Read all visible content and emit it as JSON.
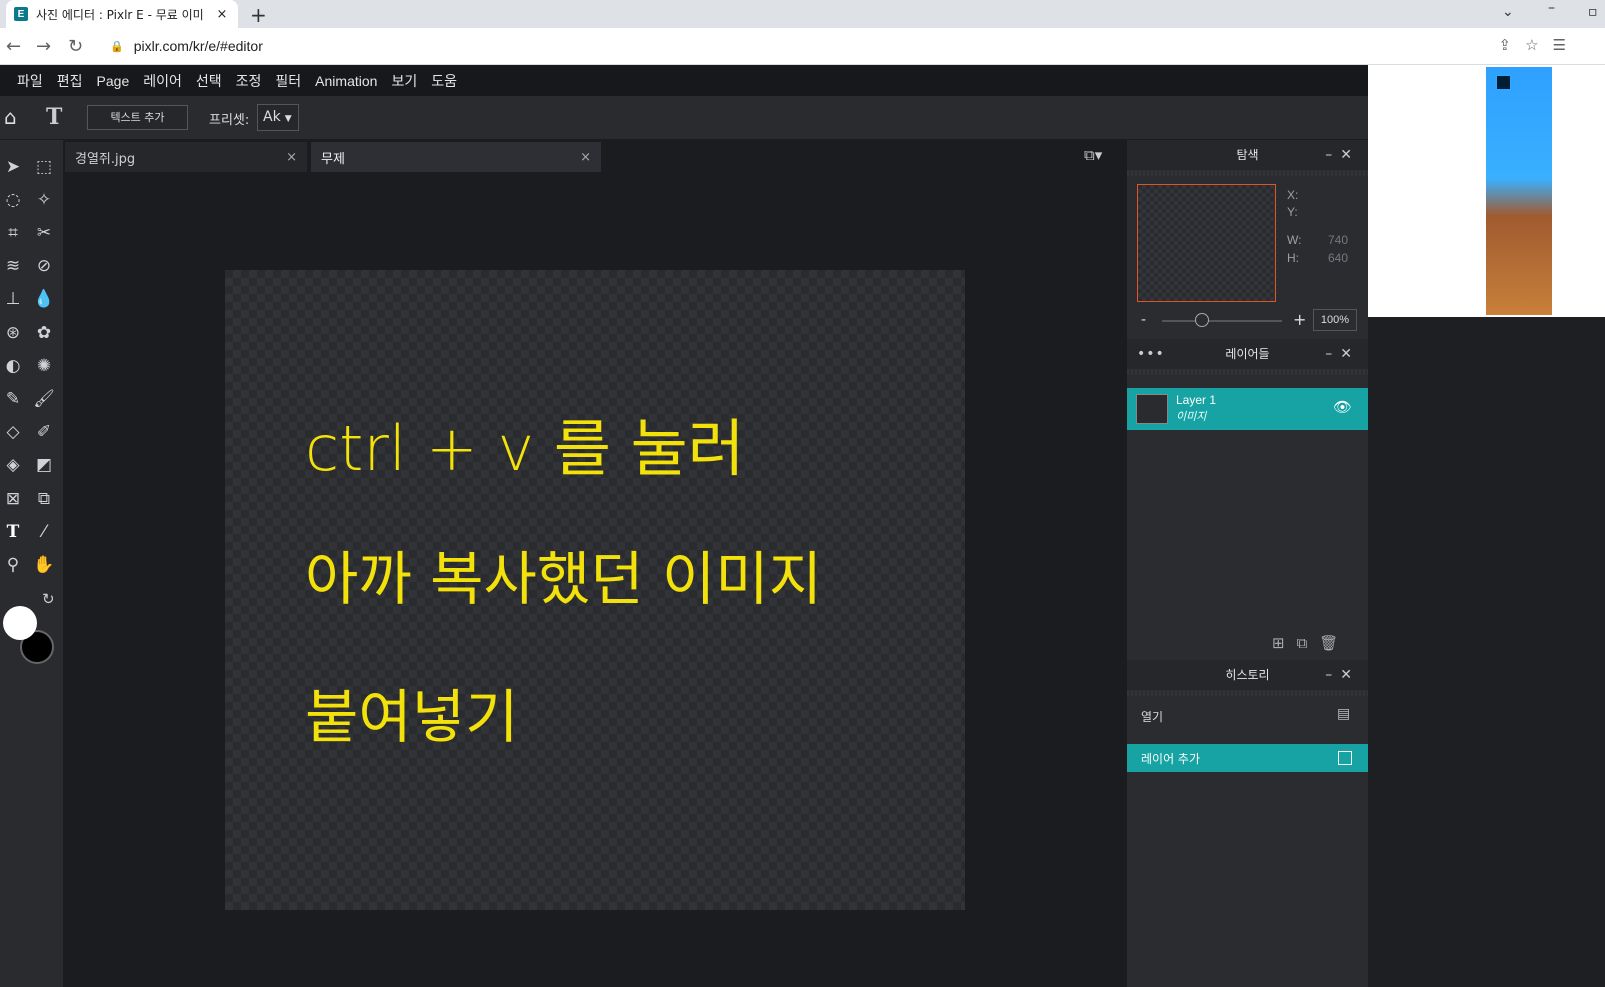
{
  "browser": {
    "tab_title": "사진 에디터 : Pixlr E - 무료 이미",
    "favicon_letter": "E",
    "close_glyph": "×",
    "new_tab_glyph": "+",
    "url": "pixlr.com/kr/e/#editor"
  },
  "menu": [
    "파일",
    "편집",
    "Page",
    "레이어",
    "선택",
    "조정",
    "필터",
    "Animation",
    "보기",
    "도움"
  ],
  "toolbar_options": {
    "add_text_label": "텍스트 추가",
    "preset_label": "프리셋:",
    "preset_value": "Ak"
  },
  "documents": {
    "tabs": [
      {
        "label": "경열쥐.jpg",
        "active": false
      },
      {
        "label": "무제",
        "active": true
      }
    ]
  },
  "canvas_text": {
    "line1": "ctrl + v 를 눌러",
    "line2": "아까 복사했던 이미지",
    "line3": "붙여넣기"
  },
  "navigator": {
    "title": "탐색",
    "x_label": "X:",
    "y_label": "Y:",
    "w_label": "W:",
    "w_value": "740",
    "h_label": "H:",
    "h_value": "640",
    "zoom": "100%",
    "zoom_fraction": 0.33
  },
  "layers": {
    "title": "레이어들",
    "items": [
      {
        "name": "Layer 1",
        "type": "이미지"
      }
    ]
  },
  "history": {
    "title": "히스토리",
    "items": [
      "열기",
      "레이어 추가"
    ]
  },
  "colors": {
    "accent": "#17a3a3",
    "canvas_text": "#f2e10a",
    "primary_color": "#ffffff",
    "secondary_color": "#000000"
  }
}
